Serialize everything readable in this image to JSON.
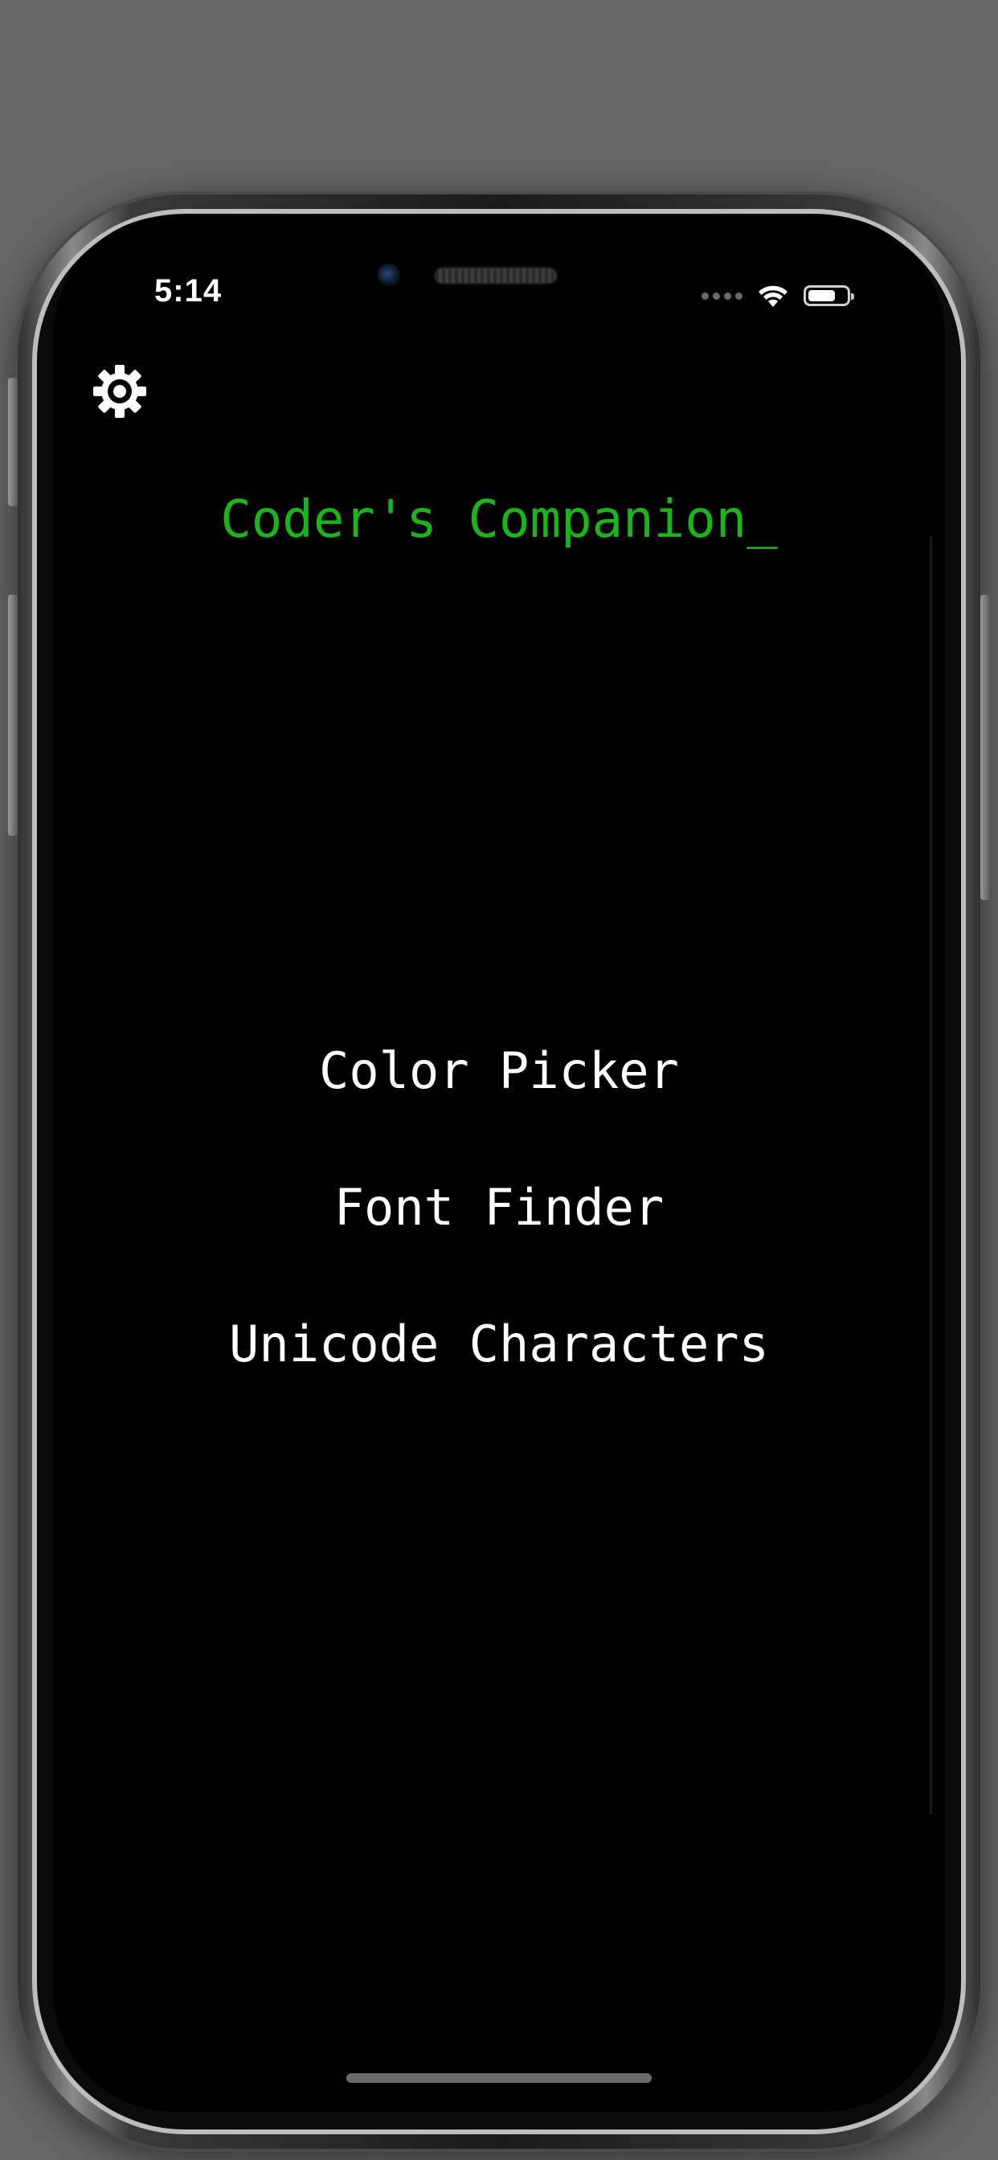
{
  "status_bar": {
    "time": "5:14"
  },
  "toolbar": {
    "settings_icon": "gear-icon"
  },
  "app": {
    "title": "Coder's Companion_"
  },
  "menu": {
    "items": [
      {
        "label": "Color Picker"
      },
      {
        "label": "Font Finder"
      },
      {
        "label": "Unicode Characters"
      }
    ]
  },
  "colors": {
    "background": "#000000",
    "title": "#19b619",
    "menu_text": "#ffffff"
  },
  "battery": {
    "level": 0.75
  }
}
